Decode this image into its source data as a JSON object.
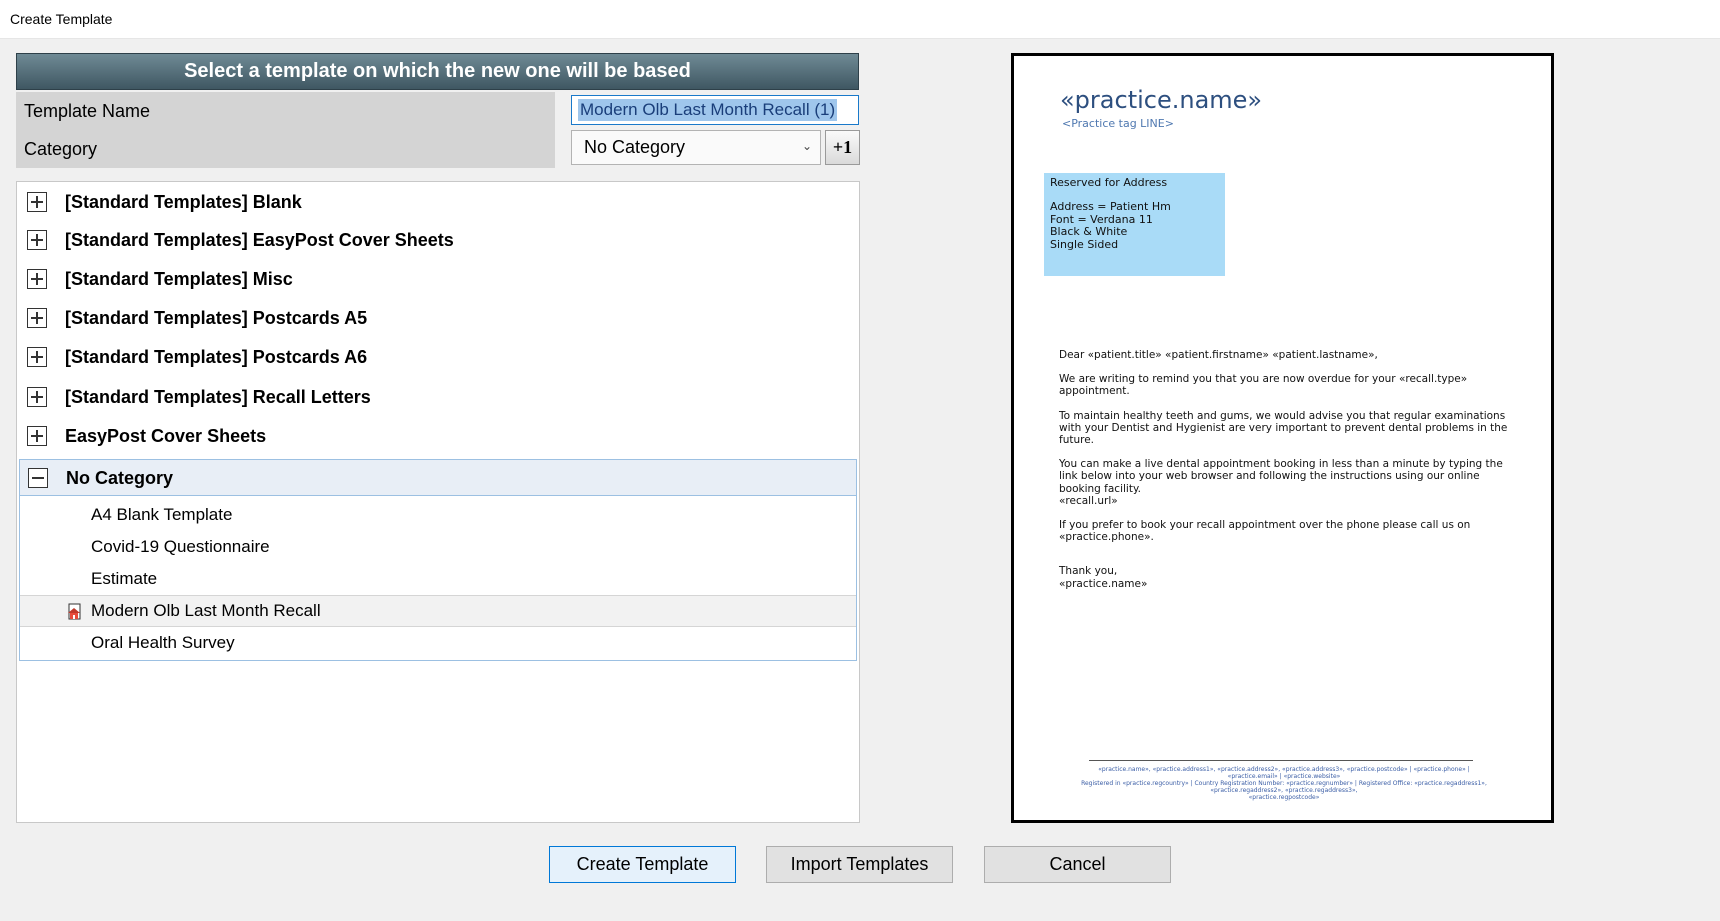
{
  "window": {
    "title": "Create Template"
  },
  "header": {
    "text": "Select a template on which the new one will be based"
  },
  "form": {
    "template_name_label": "Template Name",
    "template_name_value": "Modern Olb Last Month Recall (1)",
    "category_label": "Category",
    "category_value": "No Category",
    "add_category_label": "+1"
  },
  "tree": {
    "groups": [
      {
        "label": "[Standard Templates] Blank",
        "expanded": false
      },
      {
        "label": "[Standard Templates] EasyPost Cover Sheets",
        "expanded": false
      },
      {
        "label": "[Standard Templates] Misc",
        "expanded": false
      },
      {
        "label": "[Standard Templates] Postcards A5",
        "expanded": false
      },
      {
        "label": "[Standard Templates] Postcards A6",
        "expanded": false
      },
      {
        "label": "[Standard Templates] Recall Letters",
        "expanded": false
      },
      {
        "label": "EasyPost Cover Sheets",
        "expanded": false
      },
      {
        "label": "No Category",
        "expanded": true
      }
    ],
    "children": [
      {
        "label": "A4 Blank Template",
        "selected": false
      },
      {
        "label": "Covid-19 Questionnaire",
        "selected": false
      },
      {
        "label": "Estimate",
        "selected": false
      },
      {
        "label": "Modern Olb Last Month Recall",
        "selected": true,
        "icon": "document-house-icon"
      },
      {
        "label": "Oral Health Survey",
        "selected": false
      }
    ]
  },
  "preview": {
    "practice_name": "«practice.name»",
    "practice_tag": "<Practice tag LINE>",
    "address_box": {
      "line1": "Reserved for Address",
      "line2": "Address = Patient Hm",
      "line3": "Font = Verdana 11",
      "line4": "Black & White",
      "line5": "Single Sided"
    },
    "body": {
      "greeting": "Dear «patient.title»  «patient.firstname» «patient.lastname»,",
      "p1": "We are writing to remind you that you are now overdue for your «recall.type» appointment.",
      "p2": "To maintain healthy teeth and gums, we would advise you that regular examinations with your Dentist and Hygienist are very important to prevent dental problems in the future.",
      "p3": "You can make a live dental appointment booking in less than a minute by typing the link below into your web browser and following the instructions using our online booking facility.",
      "p3_url": "«recall.url»",
      "p4": "If you prefer to book your recall appointment over the phone please call us on «practice.phone».",
      "closing": "Thank you,",
      "signature": "«practice.name»"
    },
    "footer": {
      "line1": "«practice.name», «practice.address1», «practice.address2», «practice.address3», «practice.postcode» | «practice.phone» |",
      "line2": "«practice.email» | «practice.website»",
      "line3": "Registered in «practice.regcountry» | Country Registration Number: «practice.regnumber» | Registered Office: «practice.regaddress1», «practice.regaddress2», «practice.regaddress3»,",
      "line4": "«practice.regpostcode»"
    }
  },
  "buttons": {
    "create": "Create Template",
    "import": "Import Templates",
    "cancel": "Cancel"
  },
  "colors": {
    "header_bg": "#4f6874",
    "selection_bg": "#9fc6ec",
    "address_box_bg": "#a9dbf7",
    "accent_border": "#0078d7"
  }
}
